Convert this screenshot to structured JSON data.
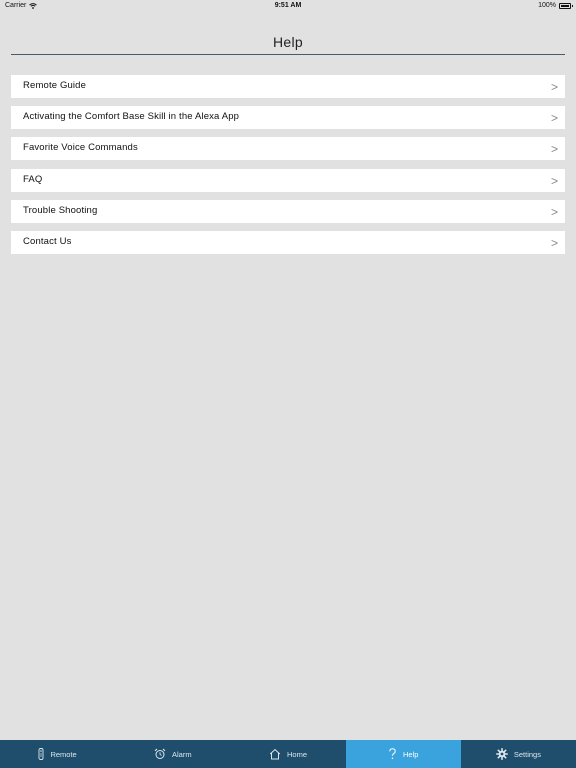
{
  "status_bar": {
    "carrier": "Carrier",
    "time": "9:51 AM",
    "battery": "100%",
    "battery_level": 1.0
  },
  "header": {
    "title": "Help"
  },
  "help_items": [
    {
      "label": "Remote Guide",
      "chevron": ">"
    },
    {
      "label": "Activating the Comfort Base  Skill in the Alexa App",
      "chevron": ">"
    },
    {
      "label": "Favorite Voice Commands",
      "chevron": ">"
    },
    {
      "label": "FAQ",
      "chevron": ">"
    },
    {
      "label": "Trouble Shooting",
      "chevron": ">"
    },
    {
      "label": "Contact Us",
      "chevron": ">"
    }
  ],
  "tab_bar": {
    "active": "help",
    "tabs": [
      {
        "id": "remote",
        "label": "Remote",
        "icon": "remote-icon"
      },
      {
        "id": "alarm",
        "label": "Alarm",
        "icon": "alarm-clock-icon"
      },
      {
        "id": "home",
        "label": "Home",
        "icon": "home-icon"
      },
      {
        "id": "help",
        "label": "Help",
        "icon": "question-mark-icon"
      },
      {
        "id": "settings",
        "label": "Settings",
        "icon": "gear-icon"
      }
    ]
  },
  "colors": {
    "background": "#e1e1e1",
    "tab_bar": "#1e4e6c",
    "tab_active": "#3aa3dd",
    "header_rule": "#4a5a6c"
  }
}
